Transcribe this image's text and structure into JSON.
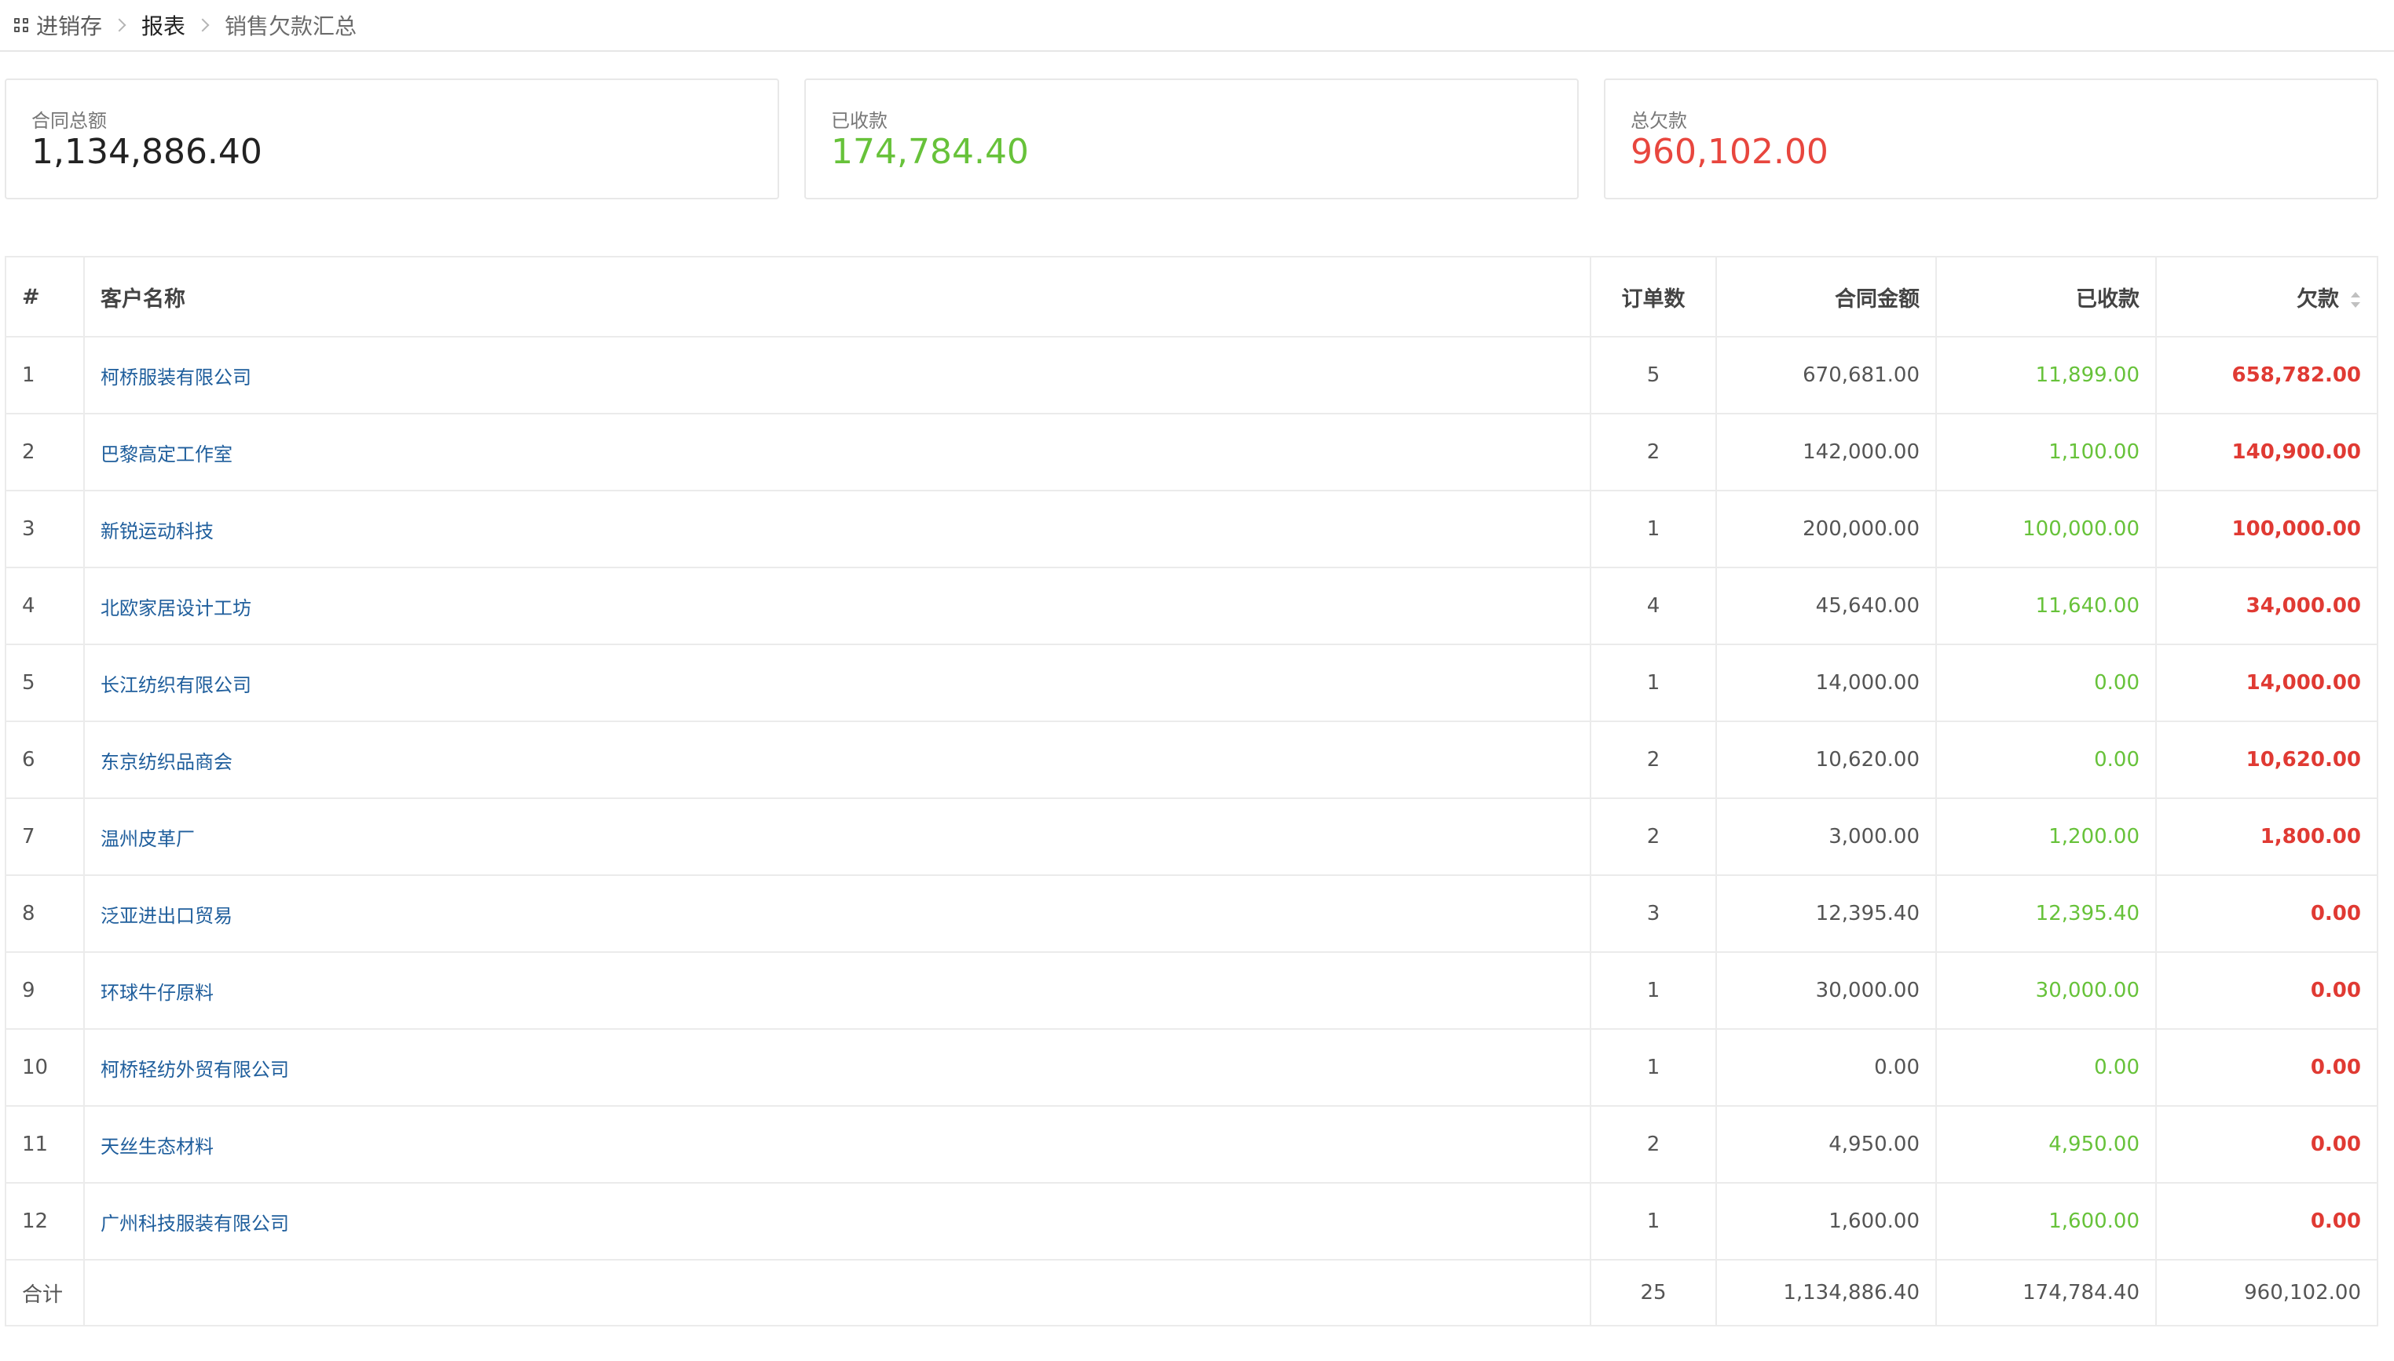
{
  "breadcrumb": {
    "items": [
      {
        "label": "进销存"
      },
      {
        "label": "报表"
      },
      {
        "label": "销售欠款汇总"
      }
    ]
  },
  "summary": {
    "contract_total": {
      "label": "合同总额",
      "value": "1,134,886.40"
    },
    "received": {
      "label": "已收款",
      "value": "174,784.40"
    },
    "total_debt": {
      "label": "总欠款",
      "value": "960,102.00"
    }
  },
  "colors": {
    "green": "#67c23a",
    "red": "#e03a33",
    "link": "#1f5e9c"
  },
  "table": {
    "headers": {
      "index": "#",
      "customer": "客户名称",
      "orders": "订单数",
      "contract_amount": "合同金额",
      "received": "已收款",
      "debt": "欠款"
    },
    "rows": [
      {
        "index": "1",
        "customer": "柯桥服装有限公司",
        "orders": "5",
        "contract_amount": "670,681.00",
        "received": "11,899.00",
        "debt": "658,782.00"
      },
      {
        "index": "2",
        "customer": "巴黎高定工作室",
        "orders": "2",
        "contract_amount": "142,000.00",
        "received": "1,100.00",
        "debt": "140,900.00"
      },
      {
        "index": "3",
        "customer": "新锐运动科技",
        "orders": "1",
        "contract_amount": "200,000.00",
        "received": "100,000.00",
        "debt": "100,000.00"
      },
      {
        "index": "4",
        "customer": "北欧家居设计工坊",
        "orders": "4",
        "contract_amount": "45,640.00",
        "received": "11,640.00",
        "debt": "34,000.00"
      },
      {
        "index": "5",
        "customer": "长江纺织有限公司",
        "orders": "1",
        "contract_amount": "14,000.00",
        "received": "0.00",
        "debt": "14,000.00"
      },
      {
        "index": "6",
        "customer": "东京纺织品商会",
        "orders": "2",
        "contract_amount": "10,620.00",
        "received": "0.00",
        "debt": "10,620.00"
      },
      {
        "index": "7",
        "customer": "温州皮革厂",
        "orders": "2",
        "contract_amount": "3,000.00",
        "received": "1,200.00",
        "debt": "1,800.00"
      },
      {
        "index": "8",
        "customer": "泛亚进出口贸易",
        "orders": "3",
        "contract_amount": "12,395.40",
        "received": "12,395.40",
        "debt": "0.00"
      },
      {
        "index": "9",
        "customer": "环球牛仔原料",
        "orders": "1",
        "contract_amount": "30,000.00",
        "received": "30,000.00",
        "debt": "0.00"
      },
      {
        "index": "10",
        "customer": "柯桥轻纺外贸有限公司",
        "orders": "1",
        "contract_amount": "0.00",
        "received": "0.00",
        "debt": "0.00"
      },
      {
        "index": "11",
        "customer": "天丝生态材料",
        "orders": "2",
        "contract_amount": "4,950.00",
        "received": "4,950.00",
        "debt": "0.00"
      },
      {
        "index": "12",
        "customer": "广州科技服装有限公司",
        "orders": "1",
        "contract_amount": "1,600.00",
        "received": "1,600.00",
        "debt": "0.00"
      }
    ],
    "footer": {
      "label": "合计",
      "orders": "25",
      "contract_amount": "1,134,886.40",
      "received": "174,784.40",
      "debt": "960,102.00"
    }
  }
}
